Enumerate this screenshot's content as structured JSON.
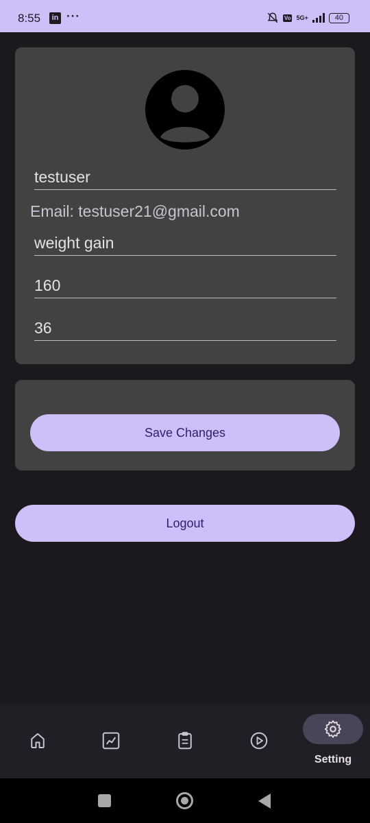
{
  "status_bar": {
    "time": "8:55",
    "battery": "40",
    "network": "5G+",
    "icons": [
      "linkedin-icon",
      "more-dots-icon",
      "mute-bell-icon",
      "volte-icon",
      "signal-icon",
      "battery-icon"
    ]
  },
  "profile": {
    "name": "testuser",
    "email_label": "Email: testuser21@gmail.com",
    "goal": "weight gain",
    "weight": "160",
    "age": "36"
  },
  "actions": {
    "save_label": "Save Changes",
    "logout_label": "Logout"
  },
  "bottom_nav": {
    "items": [
      {
        "icon": "home-icon"
      },
      {
        "icon": "chart-icon"
      },
      {
        "icon": "clipboard-icon"
      },
      {
        "icon": "play-icon"
      },
      {
        "icon": "gear-icon",
        "label": "Setting",
        "active": true
      }
    ]
  },
  "colors": {
    "accent": "#cfbff8",
    "background": "#1b181e",
    "card": "#424242",
    "button_text": "#2d1f6e"
  }
}
